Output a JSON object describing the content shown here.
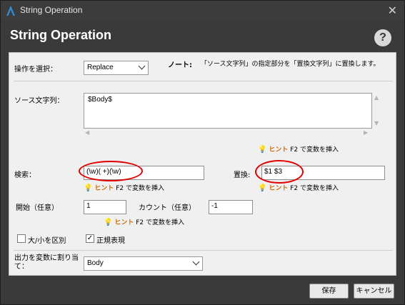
{
  "window": {
    "title": "String Operation",
    "close_glyph": "✕"
  },
  "header": {
    "title": "String Operation",
    "help_glyph": "?"
  },
  "operation": {
    "label": "操作を選択：",
    "selected": "Replace",
    "note_label": "ノート:",
    "note_text": "「ソース文字列」の指定部分を「置換文字列」に置換します。"
  },
  "source": {
    "label": "ソース文字列：",
    "value": "$Body$"
  },
  "hint": {
    "bulb_icon": "lightbulb-icon",
    "keyword": "ヒント",
    "text": "F2 で変数を挿入"
  },
  "search": {
    "label": "検索：",
    "value": "(\\w)( +)(\\w)"
  },
  "replace": {
    "label": "置換:",
    "value": "$1 $3"
  },
  "start": {
    "label": "開始（任意）",
    "value": "1"
  },
  "count": {
    "label": "カウント（任意）",
    "value": "-1"
  },
  "options": {
    "case_label": "大/小を区別",
    "case_checked": false,
    "regex_label": "正規表現",
    "regex_checked": true,
    "check_glyph": "✓"
  },
  "output": {
    "label": "出力を変数に割り当て：",
    "selected": "Body"
  },
  "footer": {
    "save_label": "保存",
    "cancel_label": "キャンセル"
  },
  "colors": {
    "highlight_circle": "#e00000",
    "hint_keyword": "#d06a00",
    "bulb": "#e8c800"
  }
}
